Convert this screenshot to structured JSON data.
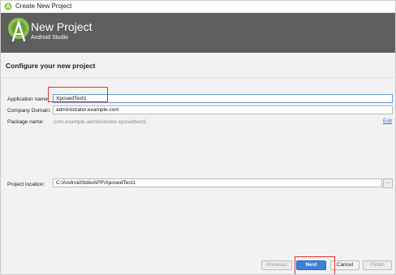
{
  "window": {
    "title": "Create New Project"
  },
  "header": {
    "title": "New Project",
    "subtitle": "Android Studio"
  },
  "section": {
    "title": "Configure your new project"
  },
  "form": {
    "app_name_label": "Application name:",
    "app_name_value": "XposedTest1",
    "company_label": "Company Domain:",
    "company_value": "administrator.example.com",
    "package_label": "Package name:",
    "package_value": "com.example.administrator.xposedtest1",
    "edit_link": "Edit",
    "location_label": "Project location:",
    "location_value": "C:\\AndroidStdioAPP\\XposedTest1",
    "browse_label": "..."
  },
  "buttons": {
    "previous": "Previous",
    "next": "Next",
    "cancel": "Cancel",
    "finish": "Finish"
  },
  "colors": {
    "header_bg": "#5e5e5e",
    "accent": "#3b80d9",
    "annotation": "#e0302e",
    "android_green": "#8bc34a"
  }
}
